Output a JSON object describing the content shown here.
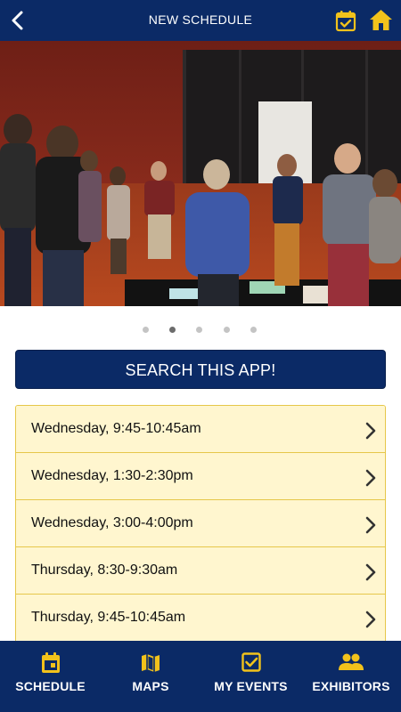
{
  "header": {
    "title": "NEW SCHEDULE",
    "back_icon": "chevron-left-icon",
    "calendar_icon": "calendar-check-icon",
    "home_icon": "home-icon"
  },
  "carousel": {
    "image_description_icon": "photo",
    "page_count": 5,
    "active_index": 1
  },
  "search": {
    "label": "SEARCH THIS APP!"
  },
  "sessions": [
    {
      "label": "Wednesday, 9:45-10:45am"
    },
    {
      "label": "Wednesday, 1:30-2:30pm"
    },
    {
      "label": "Wednesday, 3:00-4:00pm"
    },
    {
      "label": "Thursday, 8:30-9:30am"
    },
    {
      "label": "Thursday, 9:45-10:45am"
    }
  ],
  "tabs": [
    {
      "label": "SCHEDULE",
      "icon": "calendar-icon"
    },
    {
      "label": "MAPS",
      "icon": "map-icon"
    },
    {
      "label": "MY EVENTS",
      "icon": "checkbox-icon"
    },
    {
      "label": "EXHIBITORS",
      "icon": "people-icon"
    }
  ],
  "colors": {
    "navy": "#0b2a66",
    "accent_yellow": "#f2c21b",
    "row_background": "#fff6cf",
    "row_border": "#e6c74a"
  }
}
